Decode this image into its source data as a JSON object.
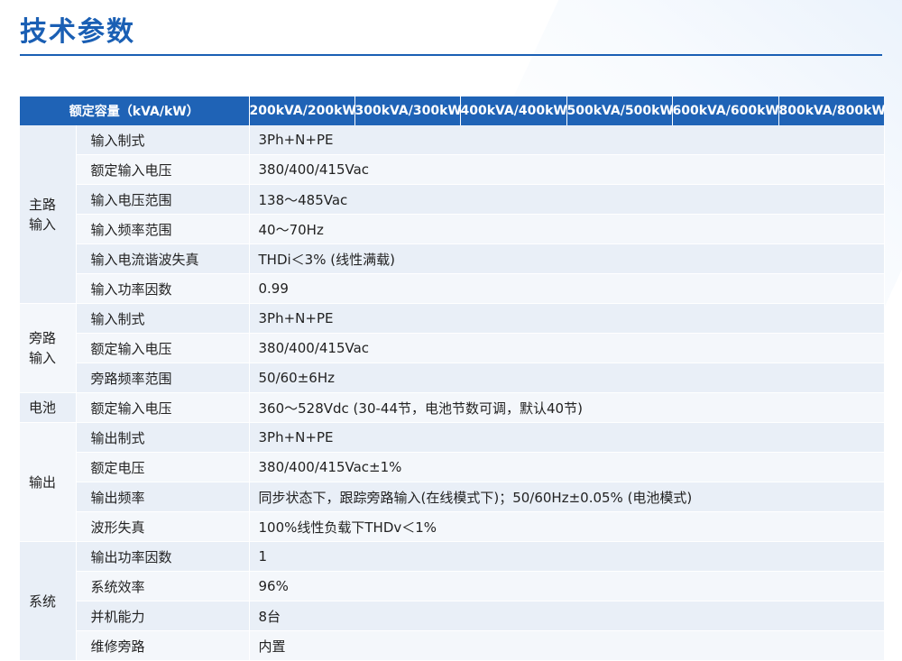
{
  "title": "技术参数",
  "header": {
    "label": "额定容量（kVA/kW）",
    "capacities": [
      "200kVA/200kW",
      "300kVA/300kW",
      "400kVA/400kW",
      "500kVA/500kW",
      "600kVA/600kW",
      "800kVA/800kW"
    ]
  },
  "groups": [
    {
      "name": "主路输入",
      "rows": [
        {
          "param": "输入制式",
          "value": "3Ph+N+PE"
        },
        {
          "param": "额定输入电压",
          "value": "380/400/415Vac"
        },
        {
          "param": "输入电压范围",
          "value": "138～485Vac"
        },
        {
          "param": "输入频率范围",
          "value": "40～70Hz"
        },
        {
          "param": "输入电流谐波失真",
          "value": "THDi＜3% (线性满载)"
        },
        {
          "param": "输入功率因数",
          "value": "0.99"
        }
      ]
    },
    {
      "name": "旁路输入",
      "rows": [
        {
          "param": "输入制式",
          "value": "3Ph+N+PE"
        },
        {
          "param": "额定输入电压",
          "value": "380/400/415Vac"
        },
        {
          "param": "旁路频率范围",
          "value": "50/60±6Hz"
        }
      ]
    },
    {
      "name": "电池",
      "rows": [
        {
          "param": "额定输入电压",
          "value": "360～528Vdc (30-44节，电池节数可调，默认40节)"
        }
      ]
    },
    {
      "name": "输出",
      "rows": [
        {
          "param": "输出制式",
          "value": "3Ph+N+PE"
        },
        {
          "param": "额定电压",
          "value": "380/400/415Vac±1%"
        },
        {
          "param": "输出频率",
          "value": "同步状态下，跟踪旁路输入(在线模式下)；50/60Hz±0.05% (电池模式)"
        },
        {
          "param": "波形失真",
          "value": "100%线性负载下THDv＜1%"
        }
      ]
    },
    {
      "name": "系统",
      "rows": [
        {
          "param": "输出功率因数",
          "value": "1"
        },
        {
          "param": "系统效率",
          "value": "96%"
        },
        {
          "param": "并机能力",
          "value": "8台"
        },
        {
          "param": "维修旁路",
          "value": "内置"
        }
      ]
    }
  ]
}
